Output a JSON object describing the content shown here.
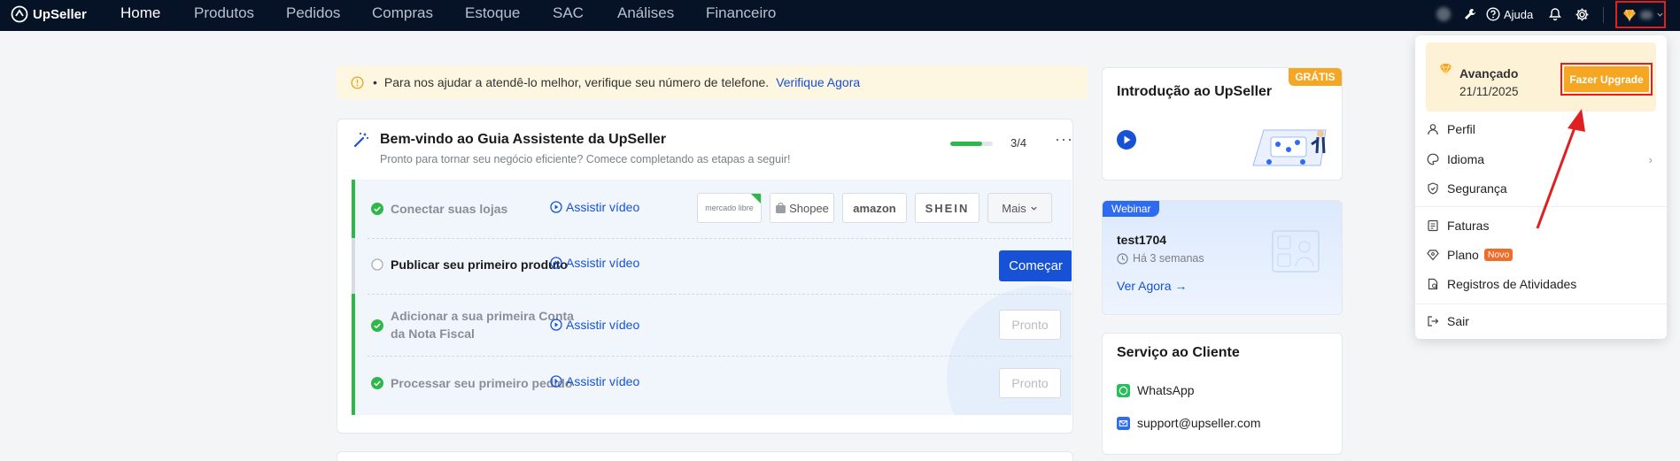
{
  "topbar": {
    "logo": "UpSeller",
    "nav": [
      {
        "label": "Home",
        "active": true
      },
      {
        "label": "Produtos",
        "active": false
      },
      {
        "label": "Pedidos",
        "active": false
      },
      {
        "label": "Compras",
        "active": false
      },
      {
        "label": "Estoque",
        "active": false
      },
      {
        "label": "SAC",
        "active": false
      },
      {
        "label": "Análises",
        "active": false
      },
      {
        "label": "Financeiro",
        "active": false
      }
    ],
    "help_label": "Ajuda"
  },
  "alert": {
    "message": "Para nos ajudar a atendê-lo melhor, verifique seu número de telefone.",
    "link": "Verifique Agora"
  },
  "guide": {
    "title": "Bem-vindo ao Guia Assistente da UpSeller",
    "subtitle": "Pronto para tornar seu negócio eficiente? Comece completando as etapas a seguir!",
    "progress_text": "3/4",
    "progress_fraction": 0.75,
    "watch_label": "Assistir vídeo",
    "steps": [
      {
        "label": "Conectar suas lojas",
        "done": true
      },
      {
        "label": "Publicar seu primeiro produto",
        "done": false,
        "action": "Começar"
      },
      {
        "label_line1": "Adicionar a sua primeira Conta",
        "label_line2": "da Nota Fiscal",
        "done": true,
        "action": "Pronto"
      },
      {
        "label": "Processar seu primeiro pedido",
        "done": true,
        "action": "Pronto"
      }
    ],
    "stores": [
      "mercado libre",
      "Shopee",
      "amazon",
      "SHEIN"
    ],
    "more_label": "Mais"
  },
  "intro": {
    "title": "Introdução ao UpSeller",
    "badge": "GRÁTIS"
  },
  "webinar": {
    "tag": "Webinar",
    "title": "test1704",
    "time": "Há 3 semanas",
    "link": "Ver Agora →"
  },
  "service": {
    "title": "Serviço ao Cliente",
    "whatsapp": "WhatsApp",
    "email": "support@upseller.com"
  },
  "account_menu": {
    "plan_name": "Avançado",
    "plan_date": "21/11/2025",
    "upgrade": "Fazer Upgrade",
    "items": [
      "Perfil",
      "Idioma",
      "Segurança",
      "Faturas",
      "Plano",
      "Registros de Atividades",
      "Sair"
    ],
    "new_badge": "Novo"
  },
  "colors": {
    "nav_bg": "#061327",
    "primary": "#1651d6",
    "success": "#2fb84a",
    "warning": "#f5a623",
    "highlight": "#e02020"
  }
}
